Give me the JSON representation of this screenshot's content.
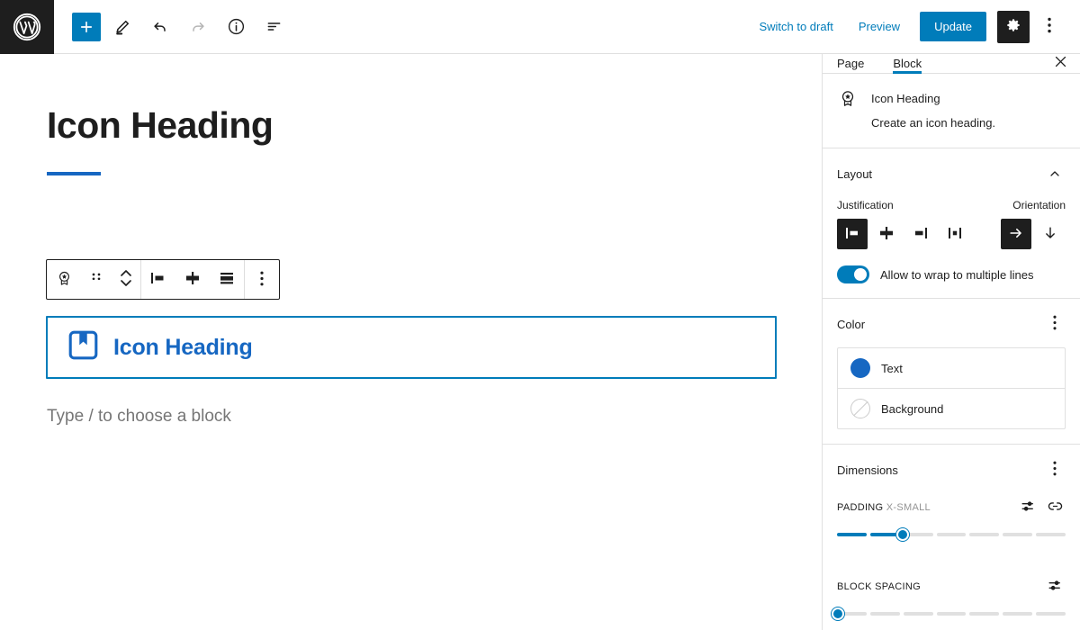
{
  "topbar": {
    "logo_icon": "wordpress-logo-icon",
    "add_label": "+",
    "tools": [
      {
        "name": "add-block-button",
        "icon": "plus-icon"
      },
      {
        "name": "edit-tool-button",
        "icon": "pencil-icon"
      },
      {
        "name": "undo-button",
        "icon": "undo-arrow-icon"
      },
      {
        "name": "redo-button",
        "icon": "redo-arrow-icon"
      },
      {
        "name": "details-button",
        "icon": "info-circle-icon"
      },
      {
        "name": "list-view-button",
        "icon": "list-view-icon"
      }
    ],
    "switch_to_draft": "Switch to draft",
    "preview": "Preview",
    "update": "Update",
    "settings_icon": "gear-icon",
    "options_icon": "kebab-menu-icon"
  },
  "canvas": {
    "post_title": "Icon Heading",
    "block_heading": "Icon Heading",
    "block_icon": "bookmark-icon",
    "placeholder": "Type / to choose a block",
    "block_toolbar": [
      {
        "name": "block-type-button",
        "icon": "award-badge-icon"
      },
      {
        "name": "drag-handle",
        "icon": "drag-dots-icon"
      },
      {
        "name": "move-updown-button",
        "icon": "chevron-updown-icon"
      },
      {
        "name": "align-left-button",
        "icon": "justify-left-icon"
      },
      {
        "name": "align-center-button",
        "icon": "justify-center-icon"
      },
      {
        "name": "align-stretch-button",
        "icon": "justify-stretch-icon"
      },
      {
        "name": "block-options-button",
        "icon": "kebab-menu-icon"
      }
    ]
  },
  "sidebar": {
    "tabs": [
      {
        "label": "Page",
        "active": false
      },
      {
        "label": "Block",
        "active": true
      }
    ],
    "close_icon": "close-icon",
    "block": {
      "icon": "award-badge-icon",
      "title": "Icon Heading",
      "description": "Create an icon heading."
    },
    "layout": {
      "title": "Layout",
      "collapse_icon": "chevron-up-icon",
      "justification_label": "Justification",
      "orientation_label": "Orientation",
      "justification_options": [
        {
          "name": "justify-left",
          "selected": true
        },
        {
          "name": "justify-center",
          "selected": false
        },
        {
          "name": "justify-right",
          "selected": false
        },
        {
          "name": "justify-space-between",
          "selected": false
        }
      ],
      "orientation_options": [
        {
          "name": "orientation-horizontal",
          "selected": true
        },
        {
          "name": "orientation-vertical",
          "selected": false
        }
      ],
      "wrap_toggle_label": "Allow to wrap to multiple lines",
      "wrap_toggle_on": true
    },
    "color": {
      "title": "Color",
      "options_icon": "kebab-menu-icon",
      "items": [
        {
          "label": "Text",
          "swatch": "#1667c2",
          "empty": false
        },
        {
          "label": "Background",
          "swatch": "",
          "empty": true
        }
      ]
    },
    "dimensions": {
      "title": "Dimensions",
      "options_icon": "kebab-menu-icon",
      "padding": {
        "label": "PADDING",
        "value": "X-SMALL",
        "sides_icon": "sliders-icon",
        "link_icon": "link-icon",
        "segments": 7,
        "filled": 2
      },
      "block_spacing": {
        "label": "BLOCK SPACING",
        "sides_icon": "sliders-icon",
        "segments": 7,
        "filled": 0
      }
    }
  },
  "colors": {
    "accent": "#007cba",
    "accent_dark": "#1667c2",
    "dark": "#1e1e1e",
    "muted": "#949494",
    "border": "#e0e0e0"
  }
}
